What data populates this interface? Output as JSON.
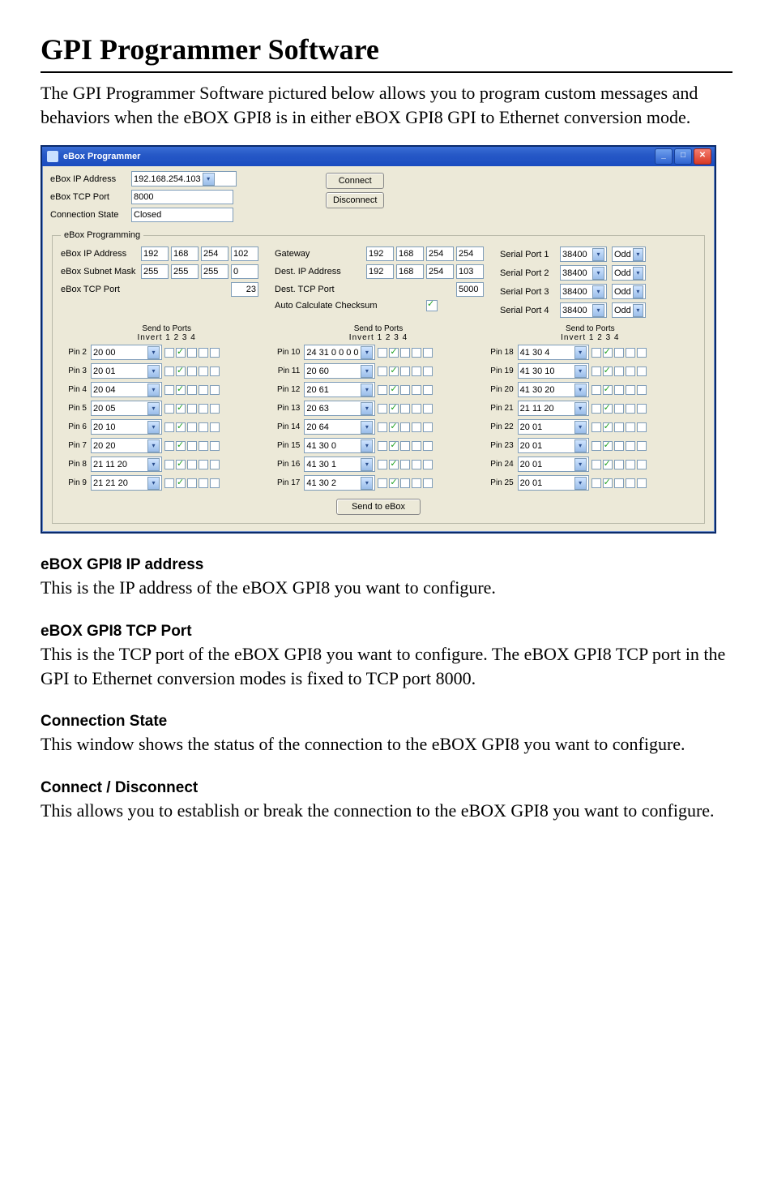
{
  "title": "GPI Programmer Software",
  "intro": "The GPI Programmer Software pictured below allows you to program custom messages and behaviors when the eBOX GPI8 is in either eBOX GPI8 GPI to Ethernet conversion mode.",
  "window": {
    "title": "eBox Programmer",
    "labels": {
      "ip": "eBox IP Address",
      "tcp": "eBox TCP Port",
      "state": "Connection State",
      "connect": "Connect",
      "disconnect": "Disconnect"
    },
    "values": {
      "ip": "192.168.254.103",
      "tcp": "8000",
      "state": "Closed"
    },
    "group_legend": "eBox Programming",
    "net": {
      "labels": {
        "ebox_ip": "eBox IP Address",
        "subnet": "eBox Subnet Mask",
        "tcp_port": "eBox TCP Port",
        "gateway": "Gateway",
        "dest_ip": "Dest. IP Address",
        "dest_tcp": "Dest. TCP Port",
        "auto_chk": "Auto Calculate Checksum"
      },
      "ebox_ip": [
        "192",
        "168",
        "254",
        "102"
      ],
      "subnet": [
        "255",
        "255",
        "255",
        "0"
      ],
      "ebox_tcp": "23",
      "gateway": [
        "192",
        "168",
        "254",
        "254"
      ],
      "dest_ip": [
        "192",
        "168",
        "254",
        "103"
      ],
      "dest_tcp": "5000",
      "auto_checked": true,
      "serial_label_prefix": "Serial Port ",
      "serial": [
        {
          "baud": "38400",
          "parity": "Odd"
        },
        {
          "baud": "38400",
          "parity": "Odd"
        },
        {
          "baud": "38400",
          "parity": "Odd"
        },
        {
          "baud": "38400",
          "parity": "Odd"
        }
      ]
    },
    "col_header_top": "Send to Ports",
    "col_header_sub": "Invert  1   2   3   4",
    "pins": [
      {
        "n": "Pin 2",
        "v": "20 00"
      },
      {
        "n": "Pin 3",
        "v": "20 01"
      },
      {
        "n": "Pin 4",
        "v": "20 04"
      },
      {
        "n": "Pin 5",
        "v": "20 05"
      },
      {
        "n": "Pin 6",
        "v": "20 10"
      },
      {
        "n": "Pin 7",
        "v": "20 20"
      },
      {
        "n": "Pin 8",
        "v": "21 11 20"
      },
      {
        "n": "Pin 9",
        "v": "21 21 20"
      },
      {
        "n": "Pin 10",
        "v": "24 31 0 0 0 0"
      },
      {
        "n": "Pin 11",
        "v": "20 60"
      },
      {
        "n": "Pin 12",
        "v": "20 61"
      },
      {
        "n": "Pin 13",
        "v": "20 63"
      },
      {
        "n": "Pin 14",
        "v": "20 64"
      },
      {
        "n": "Pin 15",
        "v": "41 30 0"
      },
      {
        "n": "Pin 16",
        "v": "41 30 1"
      },
      {
        "n": "Pin 17",
        "v": "41 30 2"
      },
      {
        "n": "Pin 18",
        "v": "41 30 4"
      },
      {
        "n": "Pin 19",
        "v": "41 30 10"
      },
      {
        "n": "Pin 20",
        "v": "41 30 20"
      },
      {
        "n": "Pin 21",
        "v": "21 11 20"
      },
      {
        "n": "Pin 22",
        "v": "20 01"
      },
      {
        "n": "Pin 23",
        "v": "20 01"
      },
      {
        "n": "Pin 24",
        "v": "20 01"
      },
      {
        "n": "Pin 25",
        "v": "20 01"
      }
    ],
    "send_btn": "Send to eBox"
  },
  "sections": [
    {
      "h": "eBOX GPI8 IP address",
      "p": "This is the IP address of the eBOX GPI8 you want to configure."
    },
    {
      "h": "eBOX GPI8 TCP Port",
      "p": "This is the TCP port of the eBOX GPI8 you want to configure. The eBOX GPI8 TCP port in the GPI to Ethernet conversion modes is fixed to TCP port 8000."
    },
    {
      "h": "Connection State",
      "p": "This window shows the status of the connection to the eBOX GPI8 you want to configure."
    },
    {
      "h": "Connect / Disconnect",
      "p": "This allows you to establish or break the connection to the eBOX GPI8 you want to configure."
    }
  ]
}
